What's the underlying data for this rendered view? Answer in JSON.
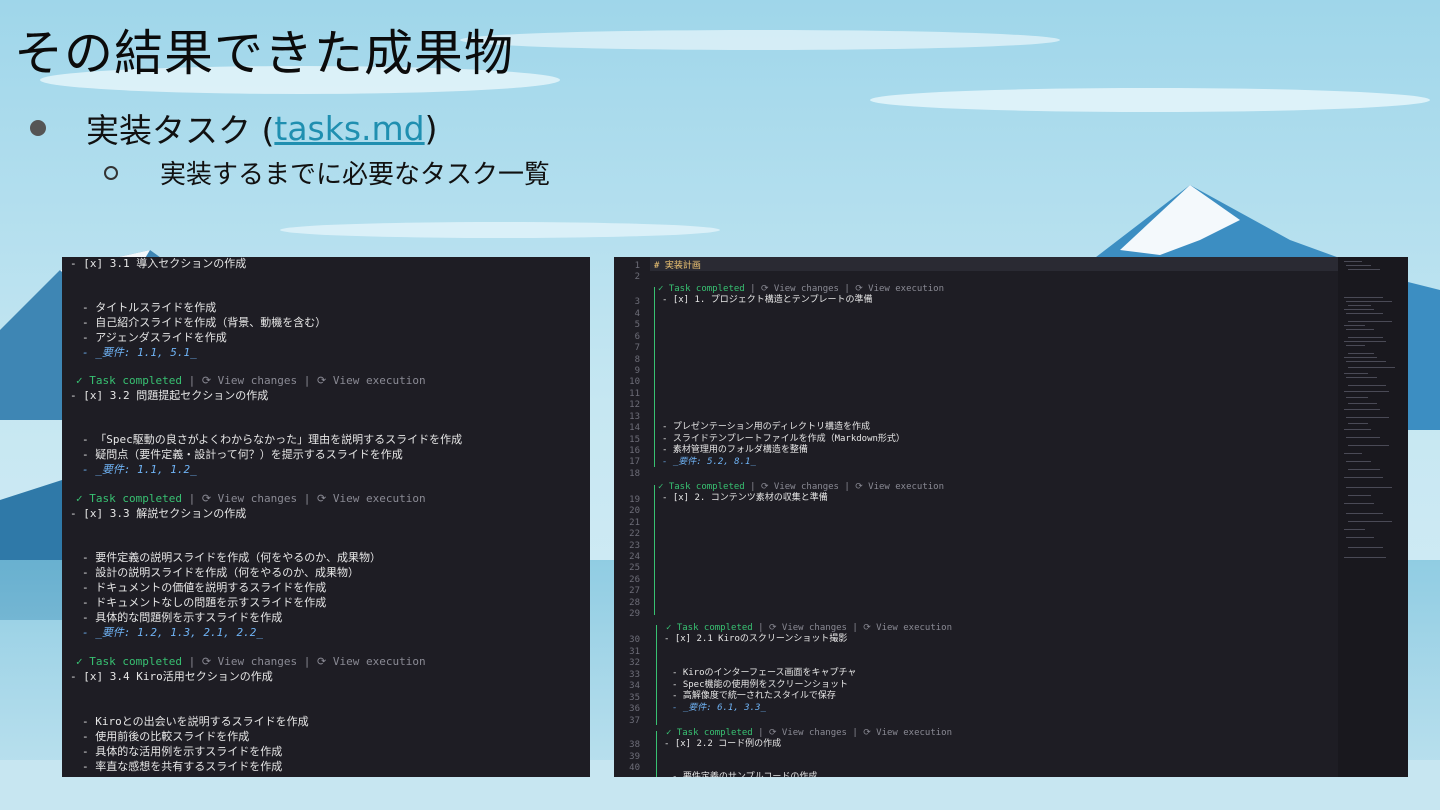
{
  "slide": {
    "title": "その結果できた成果物",
    "bullet1_prefix": "実装タスク (",
    "bullet1_link": "tasks.md",
    "bullet1_suffix": ")",
    "bullet2": "実装するまでに必要なタスク一覧"
  },
  "left_panel": {
    "lines": [
      {
        "text": "- [x] 3.1 導入セクションの作成",
        "kind": "task"
      },
      {
        "text": "- タイトルスライドを作成",
        "kind": "sub"
      },
      {
        "text": "- 自己紹介スライドを作成（背景、動機を含む）",
        "kind": "sub"
      },
      {
        "text": "- アジェンダスライドを作成",
        "kind": "sub"
      },
      {
        "text": "- _要件: 1.1, 5.1_",
        "kind": "req"
      },
      {
        "text": "✓ Task completed | ⟳ View changes | ⟳ View execution",
        "kind": "status"
      },
      {
        "text": "- [x] 3.2 問題提起セクションの作成",
        "kind": "task"
      },
      {
        "text": "- 「Spec駆動の良さがよくわからなかった」理由を説明するスライドを作成",
        "kind": "sub"
      },
      {
        "text": "- 疑問点（要件定義・設計って何？）を提示するスライドを作成",
        "kind": "sub"
      },
      {
        "text": "- _要件: 1.1, 1.2_",
        "kind": "req"
      },
      {
        "text": "✓ Task completed | ⟳ View changes | ⟳ View execution",
        "kind": "status"
      },
      {
        "text": "- [x] 3.3 解説セクションの作成",
        "kind": "task"
      },
      {
        "text": "- 要件定義の説明スライドを作成（何をやるのか、成果物）",
        "kind": "sub"
      },
      {
        "text": "- 設計の説明スライドを作成（何をやるのか、成果物）",
        "kind": "sub"
      },
      {
        "text": "- ドキュメントの価値を説明するスライドを作成",
        "kind": "sub"
      },
      {
        "text": "- ドキュメントなしの問題を示すスライドを作成",
        "kind": "sub"
      },
      {
        "text": "- 具体的な問題例を示すスライドを作成",
        "kind": "sub"
      },
      {
        "text": "- _要件: 1.2, 1.3, 2.1, 2.2_",
        "kind": "req"
      },
      {
        "text": "✓ Task completed | ⟳ View changes | ⟳ View execution",
        "kind": "status"
      },
      {
        "text": "- [x] 3.4 Kiro活用セクションの作成",
        "kind": "task"
      },
      {
        "text": "- Kiroとの出会いを説明するスライドを作成",
        "kind": "sub"
      },
      {
        "text": "- 使用前後の比較スライドを作成",
        "kind": "sub"
      },
      {
        "text": "- 具体的な活用例を示すスライドを作成",
        "kind": "sub"
      },
      {
        "text": "- 率直な感想を共有するスライドを作成",
        "kind": "sub"
      }
    ]
  },
  "right_panel": {
    "line_numbers": [
      "1",
      "2",
      "3",
      "4",
      "5",
      "6",
      "7",
      "8",
      "9",
      "10",
      "11",
      "12",
      "13",
      "14",
      "15",
      "16",
      "17",
      "18",
      "19",
      "20",
      "21",
      "22",
      "23",
      "24",
      "25",
      "26",
      "27",
      "28",
      "29",
      "30",
      "31",
      "32",
      "33",
      "34",
      "35",
      "36",
      "37",
      "38",
      "39",
      "40"
    ],
    "heading": "# 実装計画",
    "lines": [
      {
        "text": "✓ Task completed | ⟳ View changes | ⟳ View execution",
        "kind": "status"
      },
      {
        "text": "- [x] 1. プロジェクト構造とテンプレートの準備",
        "kind": "task"
      },
      {
        "text": "- プレゼンテーション用のディレクトリ構造を作成",
        "kind": "sub"
      },
      {
        "text": "- スライドテンプレートファイルを作成（Markdown形式）",
        "kind": "sub"
      },
      {
        "text": "- 素材管理用のフォルダ構造を整備",
        "kind": "sub"
      },
      {
        "text": "- _要件: 5.2, 8.1_",
        "kind": "req"
      },
      {
        "text": "✓ Task completed | ⟳ View changes | ⟳ View execution",
        "kind": "status"
      },
      {
        "text": "- [x] 2. コンテンツ素材の収集と準備",
        "kind": "task"
      },
      {
        "text": "✓ Task completed | ⟳ View changes | ⟳ View execution",
        "kind": "status"
      },
      {
        "text": "- [x] 2.1 Kiroのスクリーンショット撮影",
        "kind": "task"
      },
      {
        "text": "- Kiroのインターフェース画面をキャプチャ",
        "kind": "sub"
      },
      {
        "text": "- Spec機能の使用例をスクリーンショット",
        "kind": "sub"
      },
      {
        "text": "- 高解像度で統一されたスタイルで保存",
        "kind": "sub"
      },
      {
        "text": "- _要件: 6.1, 3.3_",
        "kind": "req"
      },
      {
        "text": "✓ Task completed | ⟳ View changes | ⟳ View execution",
        "kind": "status"
      },
      {
        "text": "- [x] 2.2 コード例の作成",
        "kind": "task"
      },
      {
        "text": "- 要件定義のサンプルコードの作成",
        "kind": "sub"
      }
    ]
  },
  "colors": {
    "panel_bg": "#1e1d24",
    "status_green": "#38c172",
    "req_blue": "#6fb3f5",
    "link": "#1f8fb0"
  }
}
